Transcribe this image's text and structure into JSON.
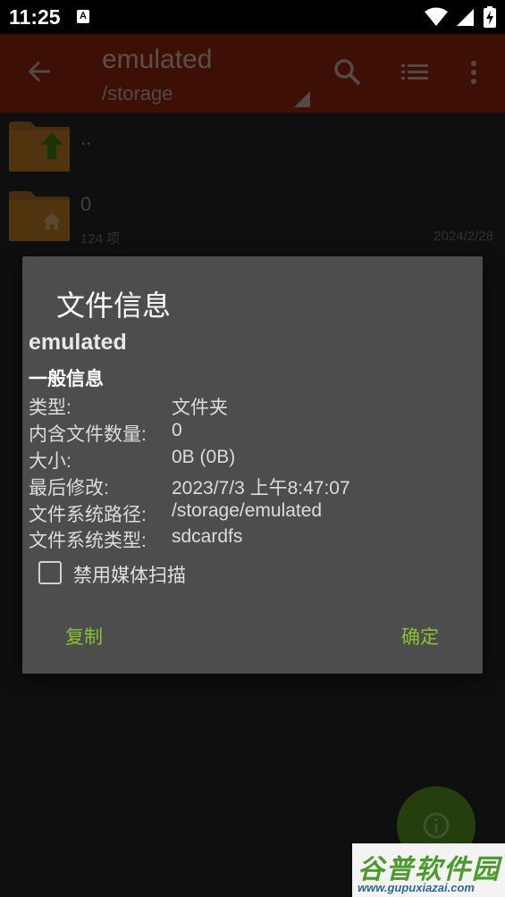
{
  "status_bar": {
    "time": "11:25",
    "notification_icon": "A"
  },
  "toolbar": {
    "title": "emulated",
    "subtitle": "/storage"
  },
  "file_list": [
    {
      "name": "..",
      "meta": "",
      "date": ""
    },
    {
      "name": "0",
      "meta": "124 项",
      "date": "2024/2/28"
    }
  ],
  "dialog": {
    "title": "文件信息",
    "file_name": "emulated",
    "section_title": "一般信息",
    "rows": [
      {
        "label": "类型:",
        "value": "文件夹"
      },
      {
        "label": "内含文件数量:",
        "value": "0"
      },
      {
        "label": "大小:",
        "value": "0B (0B)"
      },
      {
        "label": "最后修改:",
        "value": "2023/7/3 上午8:47:07"
      },
      {
        "label": "文件系统路径:",
        "value": "/storage/emulated"
      },
      {
        "label": "文件系统类型:",
        "value": "sdcardfs"
      }
    ],
    "checkbox_label": "禁用媒体扫描",
    "checkbox_checked": false,
    "copy_button": "复制",
    "ok_button": "确定"
  },
  "watermark": {
    "title": "谷普软件园",
    "url": "www.gupuxiazai.com"
  },
  "colors": {
    "toolbar": "#6b1d0a",
    "accent": "#86c232",
    "dialog_bg": "#4d4d4d",
    "fab": "#3f6c18"
  },
  "icons": [
    "back-arrow-icon",
    "search-icon",
    "list-view-icon",
    "more-vert-icon",
    "folder-up-icon",
    "folder-home-icon",
    "info-icon",
    "wifi-icon",
    "signal-icon",
    "battery-icon"
  ]
}
